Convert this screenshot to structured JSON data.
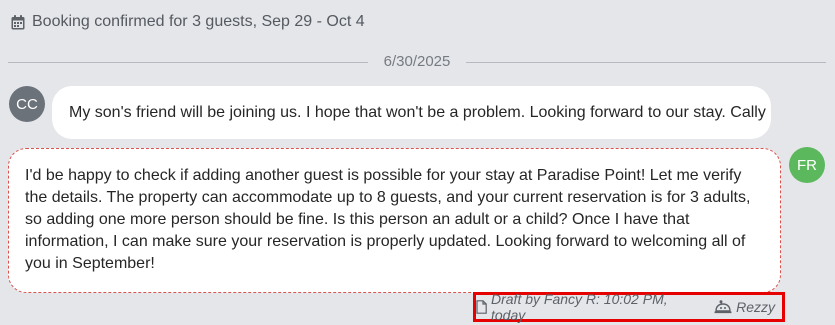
{
  "booking": {
    "icon": "calendar-icon",
    "text": "Booking confirmed for 3 guests, Sep 29 - Oct 4"
  },
  "date_divider": "6/30/2025",
  "messages": {
    "incoming": {
      "avatar_initials": "CC",
      "avatar_color": "#6c727a",
      "text": "My son's friend will be joining us. I hope that won't be a problem. Looking forward to our stay. Cally"
    },
    "outgoing": {
      "avatar_initials": "FR",
      "avatar_color": "#5cb85c",
      "text": "I'd be happy to check if adding another guest is possible for your stay at Paradise Point! Let me verify the details. The property can accommodate up to 8 guests, and your current reservation is for 3 adults, so adding one more person should be fine. Is this person an adult or a child? Once I have that information, I can make sure your reservation is properly updated. Looking forward to welcoming all of you in September!",
      "status": "draft",
      "border_color": "#d9534f"
    }
  },
  "draft_meta": {
    "draft_icon": "document-icon",
    "draft_label": "Draft by Fancy R: 10:02 PM, today",
    "agent_icon": "rezzy-bot-icon",
    "agent_label": "Rezzy",
    "highlight_color": "#e60000"
  }
}
